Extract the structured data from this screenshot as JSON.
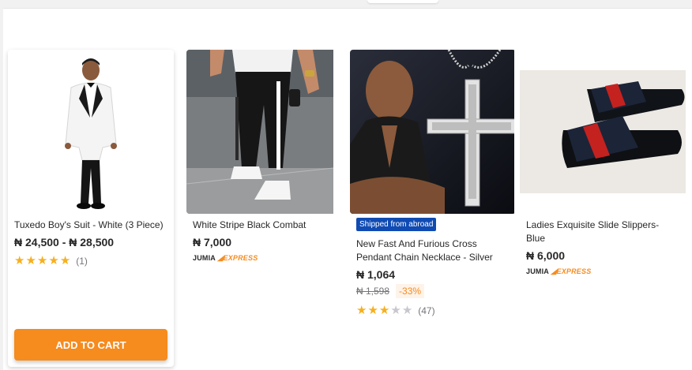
{
  "products": [
    {
      "name": "Tuxedo Boy's Suit - White (3 Piece)",
      "price": "₦ 24,500 - ₦ 28,500",
      "rating": 5,
      "rating_count": "(1)",
      "add_to_cart": "ADD TO CART",
      "image_icon": "boy-tuxedo-image"
    },
    {
      "name": "White Stripe Black Combat",
      "price": "₦ 7,000",
      "express_brand": "JUMIA",
      "express_label": "EXPRESS",
      "image_icon": "combat-trousers-image"
    },
    {
      "badge": "Shipped from abroad",
      "name": "New Fast And Furious Cross Pendant Chain Necklace - Silver",
      "price": "₦ 1,064",
      "old_price": "₦ 1,598",
      "discount": "-33%",
      "rating": 3,
      "rating_count": "(47)",
      "image_icon": "cross-necklace-image"
    },
    {
      "name": "Ladies Exquisite Slide Slippers- Blue",
      "price": "₦ 6,000",
      "express_brand": "JUMIA",
      "express_label": "EXPRESS",
      "image_icon": "slide-slippers-image"
    }
  ],
  "colors": {
    "accent": "#f68b1e",
    "star": "#f6b01e",
    "badge": "#0f4bb3"
  }
}
